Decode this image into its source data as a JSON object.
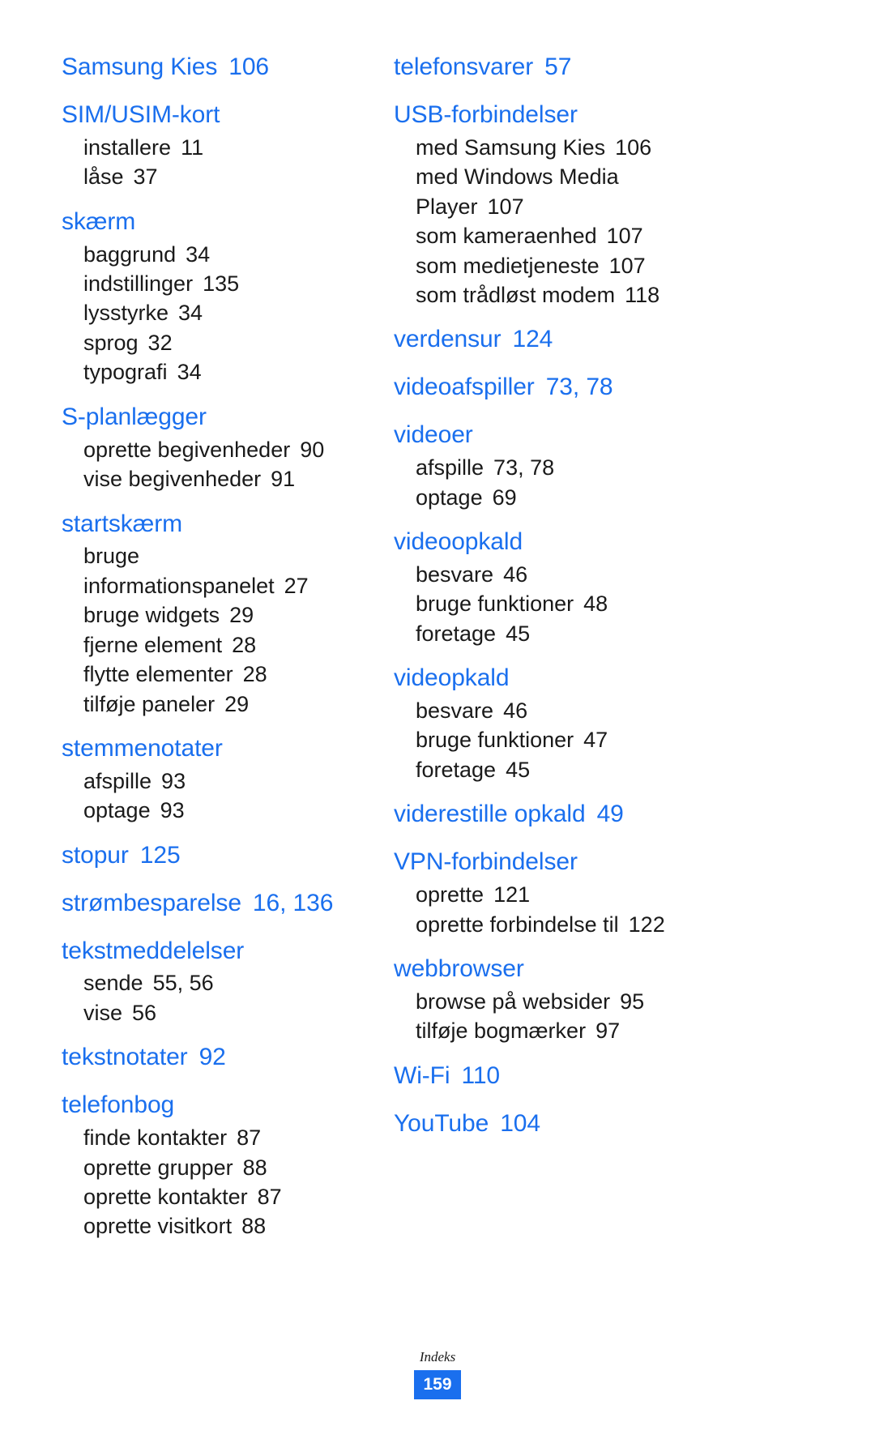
{
  "document": {
    "footer_label": "Indeks",
    "page_number": "159",
    "accent_color": "#1a6fee",
    "text_color": "#1a1a1a"
  },
  "left_column": [
    {
      "heading": "Samsung Kies",
      "pages": "106",
      "items": []
    },
    {
      "heading": "SIM/USIM-kort",
      "pages": "",
      "items": [
        {
          "label": "installere",
          "pages": "11"
        },
        {
          "label": "låse",
          "pages": "37"
        }
      ]
    },
    {
      "heading": "skærm",
      "pages": "",
      "items": [
        {
          "label": "baggrund",
          "pages": "34"
        },
        {
          "label": "indstillinger",
          "pages": "135"
        },
        {
          "label": "lysstyrke",
          "pages": "34"
        },
        {
          "label": "sprog",
          "pages": "32"
        },
        {
          "label": "typografi",
          "pages": "34"
        }
      ]
    },
    {
      "heading": "S-planlægger",
      "pages": "",
      "items": [
        {
          "label": "oprette begivenheder",
          "pages": "90"
        },
        {
          "label": "vise begivenheder",
          "pages": "91"
        }
      ]
    },
    {
      "heading": "startskærm",
      "pages": "",
      "items": [
        {
          "label": "bruge informationspanelet",
          "pages": "27",
          "wrapped": true
        },
        {
          "label": "bruge widgets",
          "pages": "29"
        },
        {
          "label": "fjerne element",
          "pages": "28"
        },
        {
          "label": "flytte elementer",
          "pages": "28"
        },
        {
          "label": "tilføje paneler",
          "pages": "29"
        }
      ]
    },
    {
      "heading": "stemmenotater",
      "pages": "",
      "items": [
        {
          "label": "afspille",
          "pages": "93"
        },
        {
          "label": "optage",
          "pages": "93"
        }
      ]
    },
    {
      "heading": "stopur",
      "pages": "125",
      "items": []
    },
    {
      "heading": "strømbesparelse",
      "pages": "16, 136",
      "items": []
    },
    {
      "heading": "tekstmeddelelser",
      "pages": "",
      "items": [
        {
          "label": "sende",
          "pages": "55, 56"
        },
        {
          "label": "vise",
          "pages": "56"
        }
      ]
    },
    {
      "heading": "tekstnotater",
      "pages": "92",
      "items": []
    },
    {
      "heading": "telefonbog",
      "pages": "",
      "items": [
        {
          "label": "finde kontakter",
          "pages": "87"
        },
        {
          "label": "oprette grupper",
          "pages": "88"
        },
        {
          "label": "oprette kontakter",
          "pages": "87"
        },
        {
          "label": "oprette visitkort",
          "pages": "88"
        }
      ]
    }
  ],
  "right_column": [
    {
      "heading": "telefonsvarer",
      "pages": "57",
      "items": []
    },
    {
      "heading": "USB-forbindelser",
      "pages": "",
      "items": [
        {
          "label": "med Samsung Kies",
          "pages": "106"
        },
        {
          "label": "med Windows Media Player",
          "pages": "107",
          "wrapped": true
        },
        {
          "label": "som kameraenhed",
          "pages": "107"
        },
        {
          "label": "som medietjeneste",
          "pages": "107"
        },
        {
          "label": "som trådløst modem",
          "pages": "118"
        }
      ]
    },
    {
      "heading": "verdensur",
      "pages": "124",
      "items": []
    },
    {
      "heading": "videoafspiller",
      "pages": "73, 78",
      "items": []
    },
    {
      "heading": "videoer",
      "pages": "",
      "items": [
        {
          "label": "afspille",
          "pages": "73, 78"
        },
        {
          "label": "optage",
          "pages": "69"
        }
      ]
    },
    {
      "heading": "videoopkald",
      "pages": "",
      "items": [
        {
          "label": "besvare",
          "pages": "46"
        },
        {
          "label": "bruge funktioner",
          "pages": "48"
        },
        {
          "label": "foretage",
          "pages": "45"
        }
      ]
    },
    {
      "heading": "videopkald",
      "pages": "",
      "items": [
        {
          "label": "besvare",
          "pages": "46"
        },
        {
          "label": "bruge funktioner",
          "pages": "47"
        },
        {
          "label": "foretage",
          "pages": "45"
        }
      ]
    },
    {
      "heading": "viderestille opkald",
      "pages": "49",
      "items": []
    },
    {
      "heading": "VPN-forbindelser",
      "pages": "",
      "items": [
        {
          "label": "oprette",
          "pages": "121"
        },
        {
          "label": "oprette forbindelse til",
          "pages": "122"
        }
      ]
    },
    {
      "heading": "webbrowser",
      "pages": "",
      "items": [
        {
          "label": "browse på websider",
          "pages": "95"
        },
        {
          "label": "tilføje bogmærker",
          "pages": "97"
        }
      ]
    },
    {
      "heading": "Wi-Fi",
      "pages": "110",
      "items": []
    },
    {
      "heading": "YouTube",
      "pages": "104",
      "items": []
    }
  ]
}
